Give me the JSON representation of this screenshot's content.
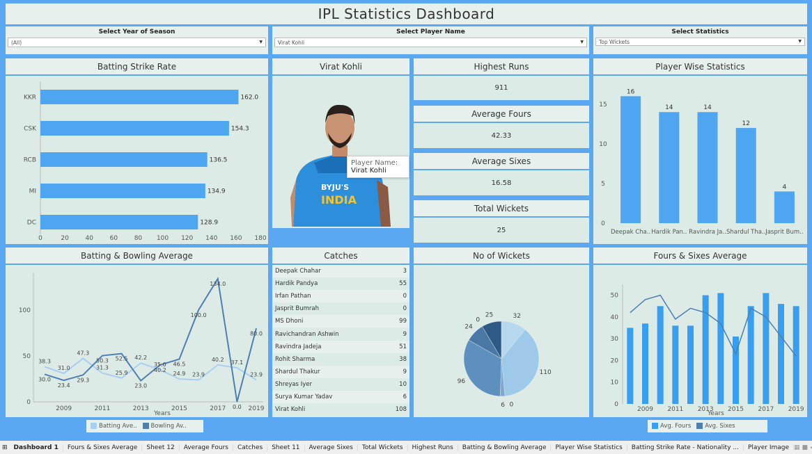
{
  "title": "IPL  Statistics Dashboard",
  "filters": [
    {
      "label": "Select Year of Season",
      "value": "(All)"
    },
    {
      "label": "Select Player Name",
      "value": "Virat Kohli"
    },
    {
      "label": "Select Statistics",
      "value": "Top Wickets"
    }
  ],
  "strike_rate": {
    "title": "Batting Strike Rate",
    "chart_data": {
      "type": "bar",
      "categories": [
        "KKR",
        "CSK",
        "RCB",
        "MI",
        "DC"
      ],
      "values": [
        162.0,
        154.3,
        136.5,
        134.9,
        128.9
      ],
      "labels": [
        "162.0",
        "154.3",
        "136.5",
        "134.9",
        "128.9"
      ],
      "xlim": [
        0,
        180
      ],
      "xticks": [
        "0",
        "20",
        "40",
        "60",
        "80",
        "100",
        "120",
        "140",
        "160",
        "180"
      ]
    }
  },
  "player": {
    "title": "Virat Kohli",
    "tooltip_label": "Player Name:",
    "tooltip_value": "Virat Kohli",
    "jersey_brand": "BYJU'S",
    "jersey_text": "INDIA"
  },
  "kpis": [
    {
      "title": "Highest Runs",
      "value": "911"
    },
    {
      "title": "Average Fours",
      "value": "42.33"
    },
    {
      "title": "Average Sixes",
      "value": "16.58"
    },
    {
      "title": "Total Wickets",
      "value": "25"
    }
  ],
  "player_wise": {
    "title": "Player Wise Statistics",
    "chart_data": {
      "type": "bar",
      "categories": [
        "Deepak Cha..",
        "Hardik Pan..",
        "Ravindra Ja..",
        "Shardul Tha..",
        "Jasprit Bum.."
      ],
      "values": [
        16,
        14,
        14,
        12,
        4
      ],
      "ylim": [
        0,
        17
      ],
      "yticks": [
        "0",
        "5",
        "10",
        "15"
      ]
    }
  },
  "bat_bowl": {
    "title": "Batting & Bowling Average",
    "xlabel": "Years",
    "legend": [
      "Batting Ave..",
      "Bowling Av.."
    ],
    "chart_data": {
      "type": "line",
      "x": [
        2008,
        2009,
        2010,
        2011,
        2012,
        2013,
        2014,
        2015,
        2016,
        2017,
        2018,
        2019
      ],
      "xticks": [
        "2009",
        "2011",
        "2013",
        "2015",
        "2017",
        "2019"
      ],
      "yticks": [
        "0",
        "50",
        "100"
      ],
      "ylim": [
        0,
        140
      ],
      "series": [
        {
          "name": "Batting Ave..",
          "values": [
            38.3,
            31.0,
            47.3,
            31.3,
            25.9,
            42.2,
            35.0,
            24.9,
            23.9,
            40.2,
            37.1,
            23.9
          ]
        },
        {
          "name": "Bowling Av..",
          "values": [
            30.0,
            23.4,
            29.3,
            50.3,
            52.5,
            23.0,
            40.2,
            46.5,
            100.0,
            134.0,
            0.0,
            80.0
          ]
        }
      ],
      "labels": [
        "38.3",
        "30.0",
        "31.0",
        "23.4",
        "47.3",
        "29.3",
        "50.3",
        "31.3",
        "25.9",
        "52.5",
        "42.2",
        "23.0",
        "35.0",
        "40.2",
        "46.5",
        "24.9",
        "100.0",
        "23.9",
        "134.0",
        "40.2",
        "37.1",
        "0.0",
        "80.0",
        "23.9"
      ]
    }
  },
  "catches": {
    "title": "Catches",
    "rows": [
      {
        "name": "Deepak Chahar",
        "value": "3"
      },
      {
        "name": "Hardik Pandya",
        "value": "55"
      },
      {
        "name": "Irfan Pathan",
        "value": "0"
      },
      {
        "name": "Jasprit Bumrah",
        "value": "0"
      },
      {
        "name": "MS Dhoni",
        "value": "99"
      },
      {
        "name": "Ravichandran Ashwin",
        "value": "9"
      },
      {
        "name": "Ravindra Jadeja",
        "value": "51"
      },
      {
        "name": "Rohit Sharma",
        "value": "38"
      },
      {
        "name": "Shardul Thakur",
        "value": "9"
      },
      {
        "name": "Shreyas Iyer",
        "value": "10"
      },
      {
        "name": "Surya Kumar Yadav",
        "value": "6"
      },
      {
        "name": "Virat Kohli",
        "value": "108"
      }
    ]
  },
  "wickets": {
    "title": "No of Wickets",
    "chart_data": {
      "type": "pie",
      "values": [
        32,
        110,
        0,
        6,
        96,
        24,
        0,
        25
      ],
      "labels": [
        "32",
        "110",
        "0",
        "6",
        "96",
        "24",
        "0",
        "25"
      ],
      "colors": [
        "#b8d8ef",
        "#9ec9e9",
        "#6a9cc7",
        "#7fa9d0",
        "#5d8fbf",
        "#4a78a6",
        "#3c6894",
        "#2f5a87"
      ]
    }
  },
  "fours_sixes": {
    "title": "Fours & Sixes Average",
    "xlabel": "Years",
    "legend": [
      "Avg. Fours",
      "Avg. Sixes"
    ],
    "chart_data": {
      "type": "bar",
      "x": [
        2008,
        2009,
        2010,
        2011,
        2012,
        2013,
        2014,
        2015,
        2016,
        2017,
        2018,
        2019
      ],
      "xticks": [
        "2009",
        "2011",
        "2013",
        "2015",
        "2017",
        "2019"
      ],
      "yticks": [
        "0",
        "10",
        "20",
        "30",
        "40",
        "50"
      ],
      "ylim": [
        0,
        55
      ],
      "series": [
        {
          "name": "Avg. Fours",
          "values": [
            35,
            37,
            45,
            36,
            36,
            50,
            51,
            31,
            45,
            51,
            46,
            45
          ]
        },
        {
          "name": "Avg. Sixes",
          "values": [
            42,
            48,
            50,
            39,
            44,
            42,
            37,
            23,
            44,
            40,
            31,
            22
          ]
        }
      ]
    }
  },
  "tabs": [
    "Dashboard 1",
    "Fours & Sixes Average",
    "Sheet 12",
    "Average Fours",
    "Catches",
    "Sheet 11",
    "Average Sixes",
    "Total Wickets",
    "Highest Runs",
    "Batting & Bowling Average",
    "Player Wise Statistics",
    "Batting Strike Rate - Nationality ...",
    "Player Image"
  ],
  "colors": {
    "bar": "#4ea6f0",
    "panel": "#dcebe6",
    "header": "#e8f0ee",
    "frame": "#5aa8f2"
  }
}
